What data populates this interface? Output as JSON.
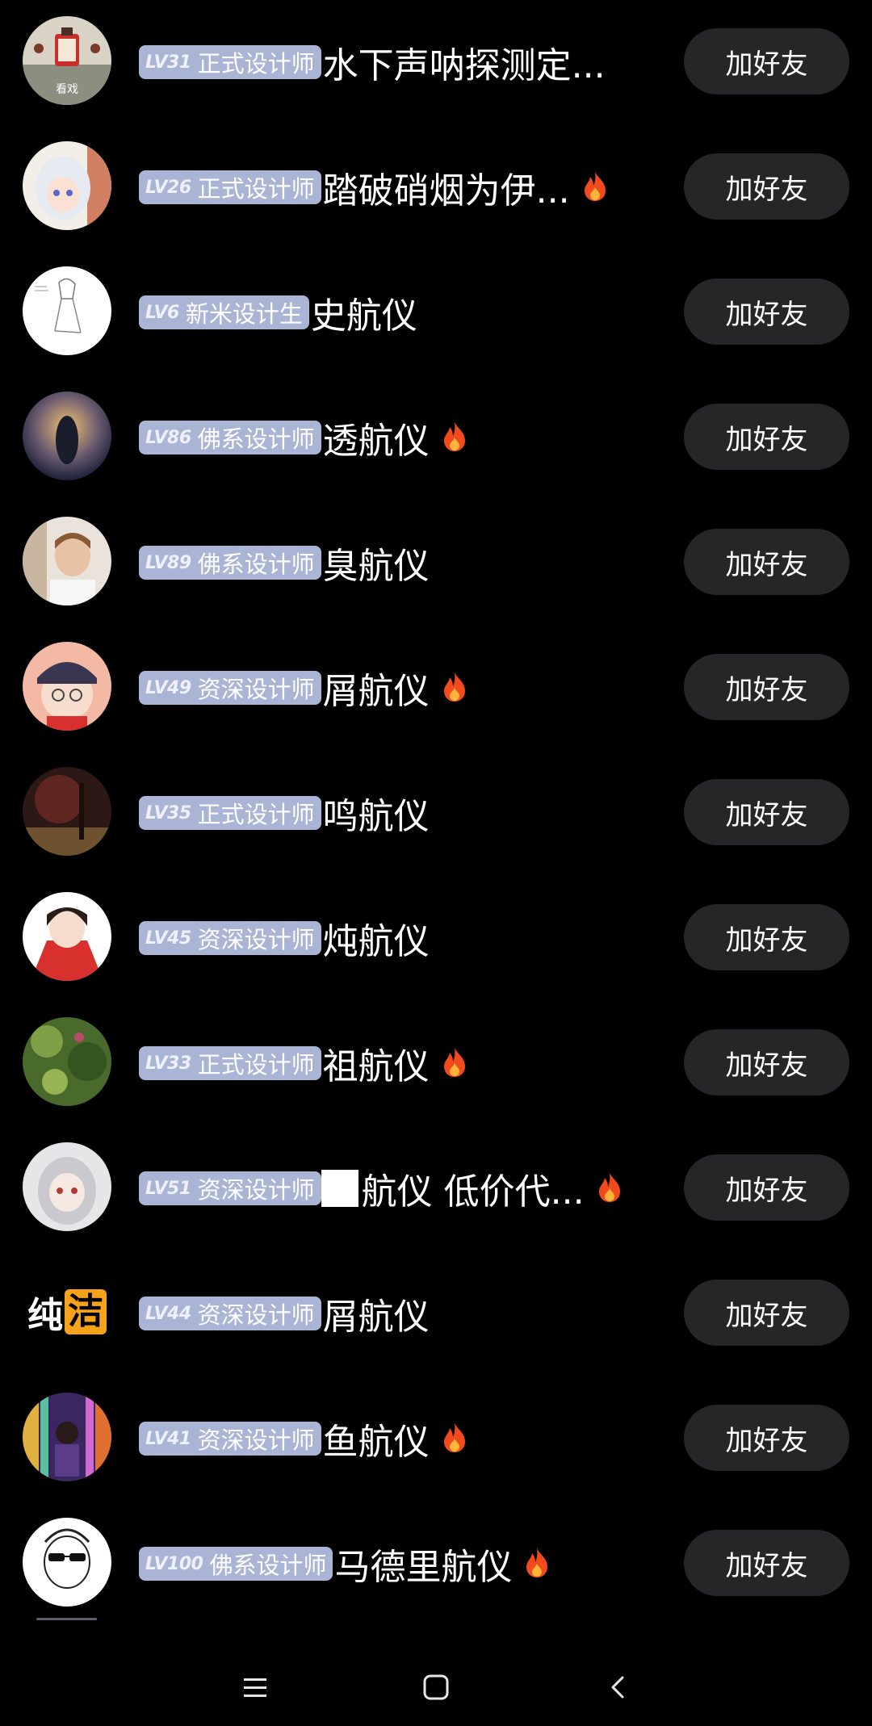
{
  "colors": {
    "background": "#000000",
    "badge": "#aab4d4",
    "button": "#262628",
    "fire": "#f04a1e"
  },
  "users": [
    {
      "level": "LV31",
      "title": "正式设计师",
      "name": "水下声呐探测定...",
      "fire": false,
      "avatar": "lantern-avatar",
      "avatar_caption": "看戏"
    },
    {
      "level": "LV26",
      "title": "正式设计师",
      "name": "踏破硝烟为伊...",
      "fire": true,
      "avatar": "anime-girl-white-hair-avatar"
    },
    {
      "level": "LV6",
      "title": "新米设计生",
      "name": "史航仪",
      "fire": false,
      "avatar": "sketch-avatar"
    },
    {
      "level": "LV86",
      "title": "佛系设计师",
      "name": "透航仪",
      "fire": true,
      "avatar": "night-lights-avatar"
    },
    {
      "level": "LV89",
      "title": "佛系设计师",
      "name": "臭航仪",
      "fire": false,
      "avatar": "photo-man-avatar"
    },
    {
      "level": "LV49",
      "title": "资深设计师",
      "name": "屑航仪",
      "fire": true,
      "avatar": "anime-girl-cap-avatar"
    },
    {
      "level": "LV35",
      "title": "正式设计师",
      "name": "鸣航仪",
      "fire": false,
      "avatar": "dark-forest-avatar"
    },
    {
      "level": "LV45",
      "title": "资深设计师",
      "name": "炖航仪",
      "fire": false,
      "avatar": "anime-girl-red-avatar"
    },
    {
      "level": "LV33",
      "title": "正式设计师",
      "name": "祖航仪",
      "fire": true,
      "avatar": "green-plants-avatar"
    },
    {
      "level": "LV51",
      "title": "资深设计师",
      "name": "航仪 低价代...",
      "fire": true,
      "avatar": "anime-girl-silver-avatar",
      "redacted": true
    },
    {
      "level": "LV44",
      "title": "资深设计师",
      "name": "屑航仪",
      "fire": false,
      "avatar": "logo-avatar",
      "logo": {
        "part1": "纯",
        "part2": "洁"
      }
    },
    {
      "level": "LV41",
      "title": "资深设计师",
      "name": "鱼航仪",
      "fire": true,
      "avatar": "colorful-forest-avatar"
    },
    {
      "level": "LV100",
      "title": "佛系设计师",
      "name": "马德里航仪",
      "fire": true,
      "avatar": "sunglasses-cartoon-avatar"
    }
  ],
  "add_friend_label": "加好友",
  "navbar": {
    "menu_icon": "menu-icon",
    "home_icon": "home-square-icon",
    "back_icon": "back-chevron-icon"
  }
}
